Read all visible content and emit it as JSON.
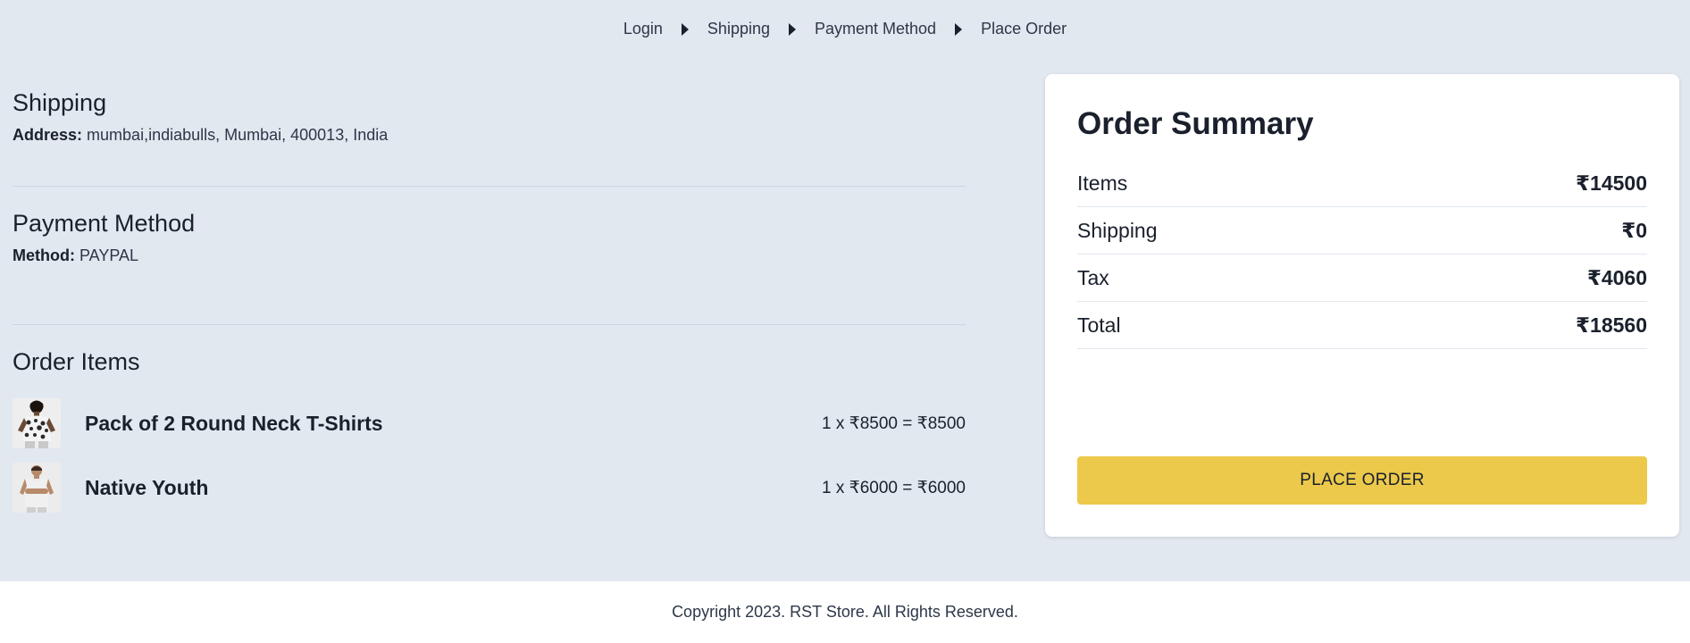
{
  "breadcrumb": {
    "items": [
      "Login",
      "Shipping",
      "Payment Method",
      "Place Order"
    ]
  },
  "shipping": {
    "title": "Shipping",
    "address_label": "Address:",
    "address_value": "mumbai,indiabulls, Mumbai, 400013, India"
  },
  "payment": {
    "title": "Payment Method",
    "method_label": "Method:",
    "method_value": "PAYPAL"
  },
  "order_items": {
    "title": "Order Items",
    "items": [
      {
        "name": "Pack of 2 Round Neck T-Shirts",
        "price_line": "1 x ₹8500 = ₹8500",
        "thumb_icon": "floral-shirt-product-image"
      },
      {
        "name": "Native Youth",
        "price_line": "1 x ₹6000 = ₹6000",
        "thumb_icon": "tank-top-product-image"
      }
    ]
  },
  "summary": {
    "title": "Order Summary",
    "rows": [
      {
        "label": "Items",
        "value": "₹14500"
      },
      {
        "label": "Shipping",
        "value": "₹0"
      },
      {
        "label": "Tax",
        "value": "₹4060"
      },
      {
        "label": "Total",
        "value": "₹18560"
      }
    ],
    "button_label": "PLACE ORDER"
  },
  "footer": {
    "text": "Copyright 2023. RST Store. All Rights Reserved."
  },
  "colors": {
    "page_bg": "#e2e8f0",
    "card_bg": "#ffffff",
    "button_bg": "#ecc94b",
    "text": "#1a202c"
  }
}
